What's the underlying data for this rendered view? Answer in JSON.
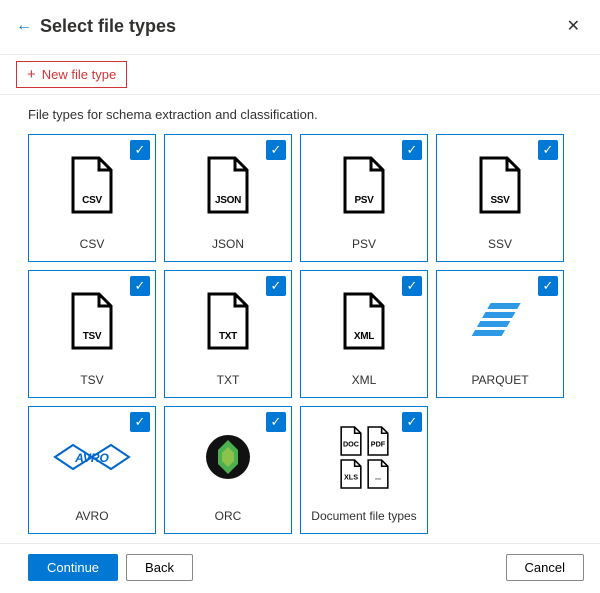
{
  "header": {
    "title": "Select file types"
  },
  "toolbar": {
    "new_file_type_label": "New file type"
  },
  "description": "File types for schema extraction and classification.",
  "tiles": [
    {
      "label": "CSV",
      "icon_text": "CSV",
      "selected": true,
      "kind": "doc"
    },
    {
      "label": "JSON",
      "icon_text": "JSON",
      "selected": true,
      "kind": "doc"
    },
    {
      "label": "PSV",
      "icon_text": "PSV",
      "selected": true,
      "kind": "doc"
    },
    {
      "label": "SSV",
      "icon_text": "SSV",
      "selected": true,
      "kind": "doc"
    },
    {
      "label": "TSV",
      "icon_text": "TSV",
      "selected": true,
      "kind": "doc"
    },
    {
      "label": "TXT",
      "icon_text": "TXT",
      "selected": true,
      "kind": "doc"
    },
    {
      "label": "XML",
      "icon_text": "XML",
      "selected": true,
      "kind": "doc"
    },
    {
      "label": "PARQUET",
      "icon_text": "",
      "selected": true,
      "kind": "parquet"
    },
    {
      "label": "AVRO",
      "icon_text": "",
      "selected": true,
      "kind": "avro"
    },
    {
      "label": "ORC",
      "icon_text": "",
      "selected": true,
      "kind": "orc"
    },
    {
      "label": "Document file types",
      "icon_text": "",
      "selected": true,
      "kind": "docs"
    }
  ],
  "footer": {
    "continue_label": "Continue",
    "back_label": "Back",
    "cancel_label": "Cancel"
  },
  "colors": {
    "primary": "#0078d4",
    "highlight": "#d13438"
  }
}
